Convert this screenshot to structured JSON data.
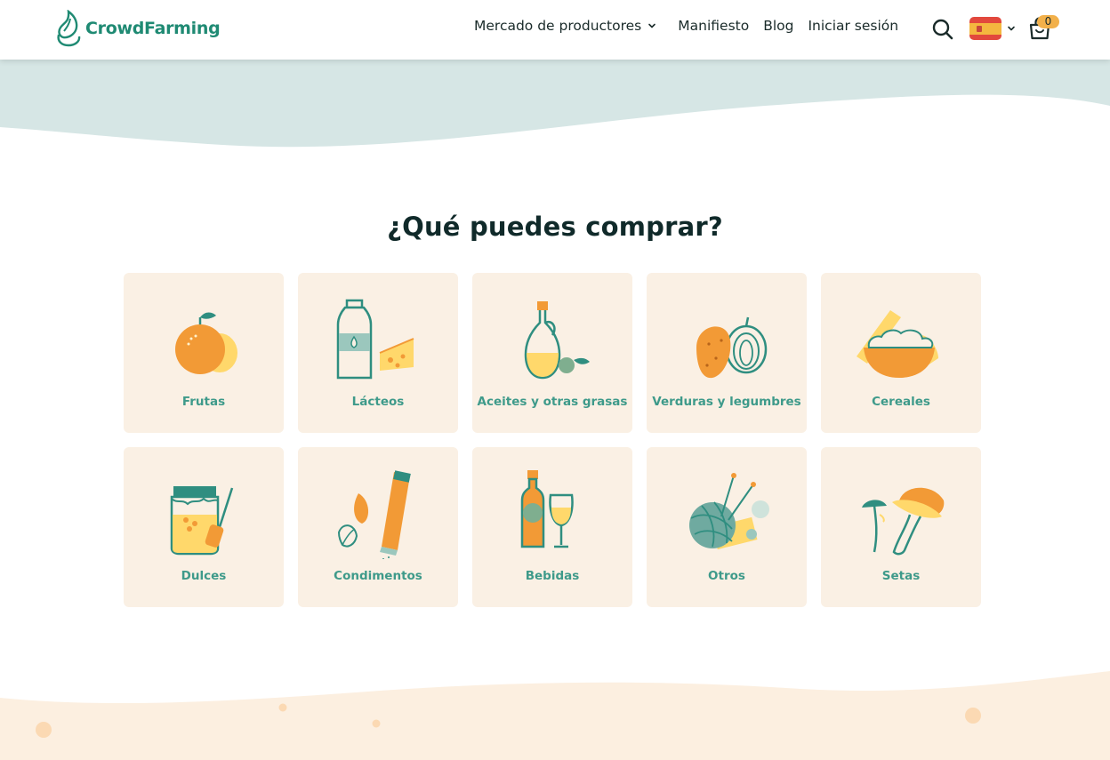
{
  "header": {
    "brand": "CrowdFarming",
    "nav": {
      "market": "Mercado de productores",
      "manifesto": "Manifiesto",
      "blog": "Blog",
      "login": "Iniciar sesión"
    },
    "cart_count": "0"
  },
  "main": {
    "title": "¿Qué puedes comprar?",
    "categories": [
      {
        "label": "Frutas",
        "icon": "fruits-icon"
      },
      {
        "label": "Lácteos",
        "icon": "dairy-icon"
      },
      {
        "label": "Aceites y otras grasas",
        "icon": "oil-icon"
      },
      {
        "label": "Verduras y legumbres",
        "icon": "vegetables-icon"
      },
      {
        "label": "Cereales",
        "icon": "cereals-icon"
      },
      {
        "label": "Dulces",
        "icon": "sweets-icon"
      },
      {
        "label": "Condimentos",
        "icon": "condiments-icon"
      },
      {
        "label": "Bebidas",
        "icon": "drinks-icon"
      },
      {
        "label": "Otros",
        "icon": "others-icon"
      },
      {
        "label": "Setas",
        "icon": "mushrooms-icon"
      }
    ]
  },
  "colors": {
    "brand_green": "#1f8a73",
    "label_teal": "#3e9a8a",
    "card_bg": "#faf0e4",
    "wave_top": "#d6e6e5",
    "wave_bottom": "#fcefe0",
    "accent_orange": "#f29a36",
    "accent_yellow": "#ffd86b"
  }
}
